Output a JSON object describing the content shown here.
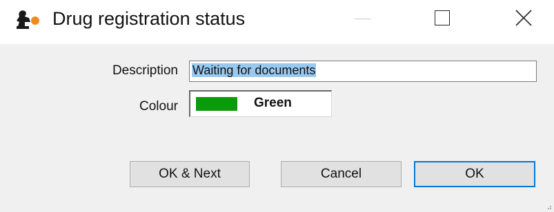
{
  "window": {
    "title": "Drug registration status",
    "app_icon": "app-logo-icon",
    "controls": {
      "minimize_icon": "minimize-icon",
      "maximize_icon": "maximize-icon",
      "close_icon": "close-icon"
    }
  },
  "form": {
    "description_label": "Description",
    "description_value": "Waiting for documents",
    "colour_label": "Colour",
    "colour_name": "Green",
    "colour_hex": "#0a9a0a"
  },
  "buttons": {
    "ok_next_label": "OK & Next",
    "cancel_label": "Cancel",
    "ok_label": "OK"
  },
  "colors": {
    "selection_highlight": "#99c9ef",
    "default_button_border": "#0078d7",
    "client_background": "#f0f0f0"
  }
}
